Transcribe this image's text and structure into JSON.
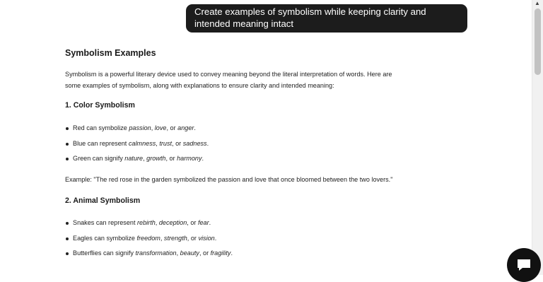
{
  "prompt": {
    "line1": "Create examples of symbolism while keeping clarity and",
    "line2": "intended meaning intact"
  },
  "response": {
    "title": "Symbolism Examples",
    "intro_line1": "Symbolism is a powerful literary device used to convey meaning beyond the literal interpretation of words. Here are",
    "intro_line2": "some examples of symbolism, along with explanations to ensure clarity and intended meaning:",
    "sections": [
      {
        "heading": "1. Color Symbolism",
        "items": [
          {
            "lead": "Red can symbolize ",
            "i1": "passion",
            "s1": ", ",
            "i2": "love",
            "s2": ", or ",
            "i3": "anger",
            "end": "."
          },
          {
            "lead": "Blue can represent ",
            "i1": "calmness",
            "s1": ", ",
            "i2": "trust",
            "s2": ", or ",
            "i3": "sadness",
            "end": "."
          },
          {
            "lead": "Green can signify ",
            "i1": "nature",
            "s1": ", ",
            "i2": "growth",
            "s2": ", or ",
            "i3": "harmony",
            "end": "."
          }
        ],
        "example": "Example: \"The red rose in the garden symbolized the passion and love that once bloomed between the two lovers.\""
      },
      {
        "heading": "2. Animal Symbolism",
        "items": [
          {
            "lead": "Snakes can represent ",
            "i1": "rebirth",
            "s1": ", ",
            "i2": "deception",
            "s2": ", or ",
            "i3": "fear",
            "end": "."
          },
          {
            "lead": "Eagles can symbolize ",
            "i1": "freedom",
            "s1": ", ",
            "i2": "strength",
            "s2": ", or ",
            "i3": "vision",
            "end": "."
          },
          {
            "lead": "Butterflies can signify ",
            "i1": "transformation",
            "s1": ", ",
            "i2": "beauty",
            "s2": ", or ",
            "i3": "fragility",
            "end": "."
          }
        ]
      }
    ]
  },
  "icons": {
    "scroll_up": "scroll-up-arrow-icon",
    "chat": "chat-bubble-icon"
  }
}
